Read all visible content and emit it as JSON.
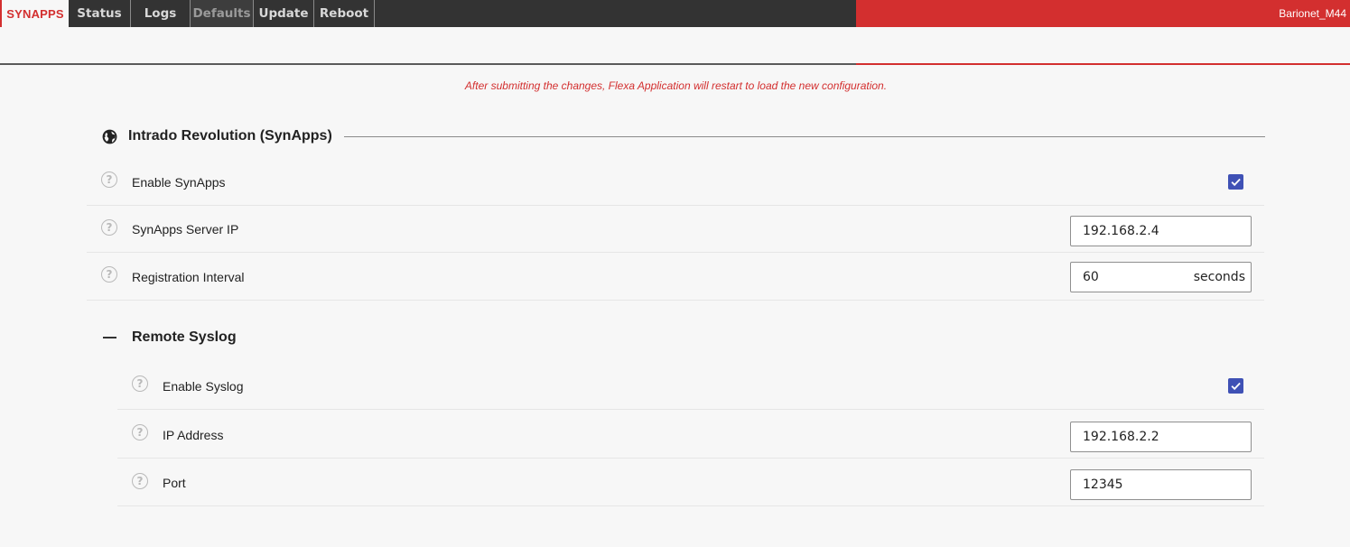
{
  "nav": {
    "brand": "SYNAPPS",
    "tabs": [
      {
        "label": "Status"
      },
      {
        "label": "Logs"
      },
      {
        "label": "Defaults"
      },
      {
        "label": "Update"
      },
      {
        "label": "Reboot"
      }
    ],
    "device_name": "Barionet_M44"
  },
  "notice": "After submitting the changes, Flexa Application will restart to load the new configuration.",
  "section": {
    "title": "Intrado Revolution (SynApps)",
    "rows": {
      "enable": {
        "label": "Enable SynApps",
        "checked": true
      },
      "server_ip": {
        "label": "SynApps Server IP",
        "value": "192.168.2.4"
      },
      "interval": {
        "label": "Registration Interval",
        "value": "60",
        "unit": "seconds"
      }
    }
  },
  "syslog": {
    "title": "Remote Syslog",
    "rows": {
      "enable": {
        "label": "Enable Syslog",
        "checked": true
      },
      "ip": {
        "label": "IP Address",
        "value": "192.168.2.2"
      },
      "port": {
        "label": "Port",
        "value": "12345"
      }
    }
  },
  "colors": {
    "accent_red": "#d32f2f",
    "checkbox_blue": "#3f51b5",
    "nav_dark": "#333333"
  },
  "icons": {
    "section": "globe-icon",
    "help": "help-circle-icon",
    "collapse": "minus-icon",
    "check": "check-icon"
  }
}
